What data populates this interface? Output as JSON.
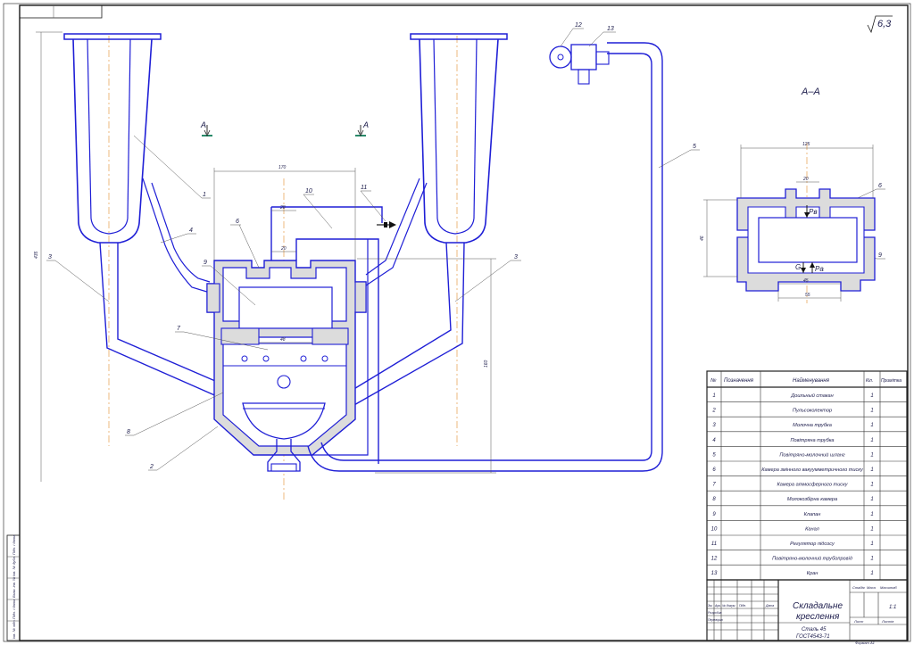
{
  "roughness": "6,3",
  "section_label": "A–A",
  "cut_marks": [
    "A",
    "A"
  ],
  "callouts": [
    "1",
    "2",
    "3",
    "3",
    "4",
    "5",
    "6",
    "6",
    "7",
    "8",
    "9",
    "9",
    "10",
    "11",
    "12",
    "13"
  ],
  "section_labels": {
    "pv": "Pв",
    "g": "G",
    "pa": "Pа"
  },
  "dimensions": {
    "d1": "435",
    "d2": "28",
    "d3": "20",
    "d4": "48",
    "d5": "170",
    "d6": "160",
    "s1": "125",
    "s2": "20",
    "s3": "46",
    "s4": "45",
    "s5": "55"
  },
  "spec": {
    "headers": {
      "num": "№",
      "designation": "Позначення",
      "name": "Найменування",
      "qty": "Кіл.",
      "note": "Примітка"
    },
    "rows": [
      {
        "n": "1",
        "name": "Доильный стакан",
        "q": "1"
      },
      {
        "n": "2",
        "name": "Пульсоколектор",
        "q": "1"
      },
      {
        "n": "3",
        "name": "Молочна трубка",
        "q": "1"
      },
      {
        "n": "4",
        "name": "Повітряна трубка",
        "q": "1"
      },
      {
        "n": "5",
        "name": "Повітряно-молочний шланг",
        "q": "1"
      },
      {
        "n": "6",
        "name": "Камера змінного вакуумметричного тиску",
        "q": "1"
      },
      {
        "n": "7",
        "name": "Камера атмосферного тиску",
        "q": "1"
      },
      {
        "n": "8",
        "name": "Молокозбірна камера",
        "q": "1"
      },
      {
        "n": "9",
        "name": "Клапан",
        "q": "1"
      },
      {
        "n": "10",
        "name": "Канал",
        "q": "1"
      },
      {
        "n": "11",
        "name": "Регулятор підсосу",
        "q": "1"
      },
      {
        "n": "12",
        "name": "Повітряно-молочний трубопровід",
        "q": "1"
      },
      {
        "n": "13",
        "name": "Кран",
        "q": "1"
      }
    ]
  },
  "title_block": {
    "title_line1": "Складальне",
    "title_line2": "креслення",
    "material_line1": "Сталь 45",
    "material_line2": "ГОСТ4543-71",
    "col_stage": "Стадія",
    "col_mass": "Маса",
    "col_scale": "Масштаб",
    "scale": "1:1",
    "sheet": "Лист",
    "sheets": "Листів",
    "row_headers": [
      "Зм.",
      "Арк.",
      "№ докум.",
      "Підп.",
      "Дата"
    ],
    "roles": [
      "Розробив",
      "Перевірив"
    ],
    "format": "Формат  А1"
  },
  "side_stamp": [
    "Інв. № підп.",
    "Підп. і дата",
    "Взам. інв. №",
    "Інв. № дубл.",
    "Підп. і дата"
  ]
}
